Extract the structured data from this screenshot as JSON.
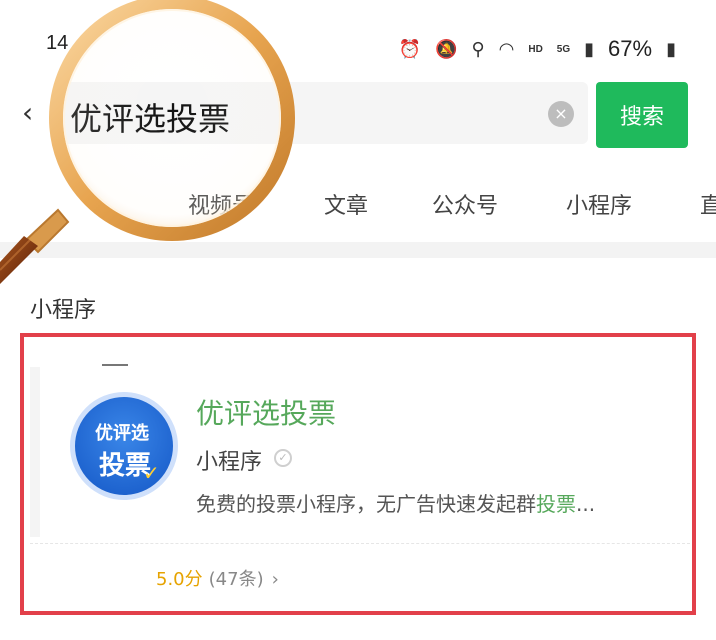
{
  "status_bar": {
    "time": "14",
    "battery_percent": "67%",
    "hd": "HD",
    "net": "5G"
  },
  "search": {
    "query": "优评选投票",
    "button_label": "搜索"
  },
  "tabs": [
    "视频号",
    "文章",
    "公众号",
    "小程序",
    "直"
  ],
  "section_title": "小程序",
  "result": {
    "logo_line1": "优评选",
    "logo_line2": "投票",
    "name": "优评选投票",
    "type": "小程序",
    "description_prefix": "免费的投票小程序，无广告快速发起群",
    "description_highlight": "投票",
    "description_suffix": "...",
    "rating_score": "5.0分",
    "rating_count": "(47条)",
    "rating_chevron": "›"
  },
  "colors": {
    "brand_green": "#1fba5c",
    "highlight_green": "#56a85b",
    "frame_red": "#e2404a",
    "rating_gold": "#e6a300"
  },
  "icons": {
    "back": "chevron-left-icon",
    "clear": "clear-icon",
    "filter": "filter-icon",
    "verified": "verified-icon",
    "magnifier": "magnifier-icon"
  }
}
